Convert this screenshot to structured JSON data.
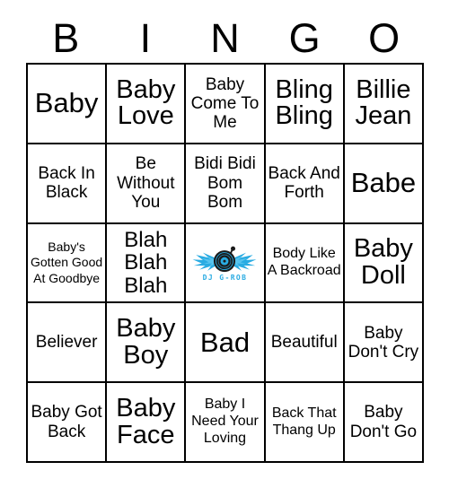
{
  "header": {
    "letters": [
      "B",
      "I",
      "N",
      "G",
      "O"
    ]
  },
  "colors": {
    "grid_line": "#000000",
    "background": "#ffffff",
    "text": "#000000",
    "logo_cyan": "#29ABE2",
    "logo_cyan_light": "#7FD8F7",
    "logo_dark": "#1A1A1A"
  },
  "free_space": {
    "logo_name": "dj-g-rob-logo",
    "logo_text": "DJ G-ROB"
  },
  "grid": {
    "rows": [
      [
        {
          "text": "Baby",
          "size": "fs-xxl"
        },
        {
          "text": "Baby Love",
          "size": "fs-xl"
        },
        {
          "text": "Baby Come To Me",
          "size": "fs-md"
        },
        {
          "text": "Bling Bling",
          "size": "fs-xl"
        },
        {
          "text": "Billie Jean",
          "size": "fs-xl"
        }
      ],
      [
        {
          "text": "Back In Black",
          "size": "fs-md"
        },
        {
          "text": "Be Without You",
          "size": "fs-md"
        },
        {
          "text": "Bidi Bidi Bom Bom",
          "size": "fs-md"
        },
        {
          "text": "Back And Forth",
          "size": "fs-md"
        },
        {
          "text": "Babe",
          "size": "fs-xxl"
        }
      ],
      [
        {
          "text": "Baby's Gotten Good At Goodbye",
          "size": "fs-xs"
        },
        {
          "text": "Blah Blah Blah",
          "size": "fs-lg"
        },
        {
          "text": "",
          "size": "free"
        },
        {
          "text": "Body Like A Backroad",
          "size": "fs-sm"
        },
        {
          "text": "Baby Doll",
          "size": "fs-xl"
        }
      ],
      [
        {
          "text": "Believer",
          "size": "fs-md"
        },
        {
          "text": "Baby Boy",
          "size": "fs-xl"
        },
        {
          "text": "Bad",
          "size": "fs-xxl"
        },
        {
          "text": "Beautiful",
          "size": "fs-md"
        },
        {
          "text": "Baby Don't Cry",
          "size": "fs-md"
        }
      ],
      [
        {
          "text": "Baby Got Back",
          "size": "fs-md"
        },
        {
          "text": "Baby Face",
          "size": "fs-xl"
        },
        {
          "text": "Baby I Need Your Loving",
          "size": "fs-sm"
        },
        {
          "text": "Back That Thang Up",
          "size": "fs-sm"
        },
        {
          "text": "Baby Don't Go",
          "size": "fs-md"
        }
      ]
    ]
  }
}
